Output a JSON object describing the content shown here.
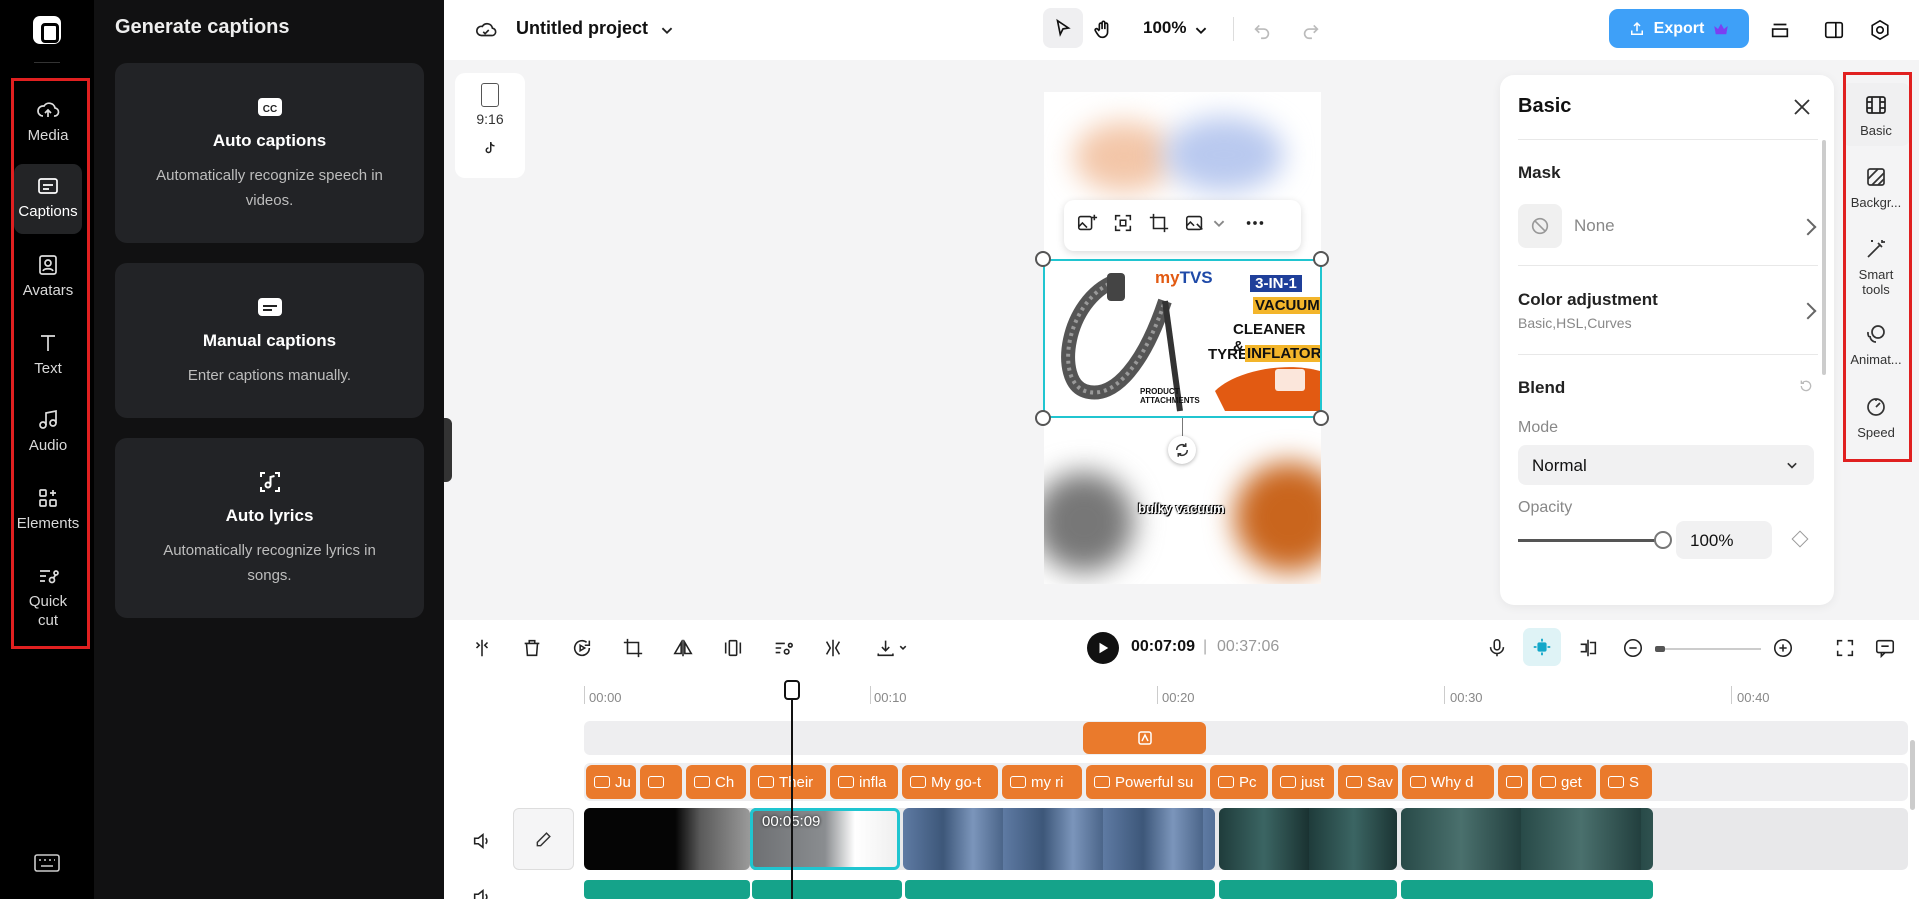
{
  "rail": {
    "items": [
      {
        "label": "Media",
        "icon": "cloud-upload-icon"
      },
      {
        "label": "Captions",
        "icon": "captions-icon"
      },
      {
        "label": "Avatars",
        "icon": "avatar-icon"
      },
      {
        "label": "Text",
        "icon": "text-icon"
      },
      {
        "label": "Audio",
        "icon": "music-note-icon"
      },
      {
        "label": "Elements",
        "icon": "elements-icon"
      },
      {
        "label": "Quick cut",
        "icon": "quick-cut-icon"
      }
    ],
    "keyboard_icon": "keyboard-icon"
  },
  "captions_panel": {
    "title": "Generate captions",
    "cards": [
      {
        "title": "Auto captions",
        "desc": "Automatically recognize speech in videos.",
        "icon": "cc-icon"
      },
      {
        "title": "Manual captions",
        "desc": "Enter captions manually.",
        "icon": "subtitles-icon"
      },
      {
        "title": "Auto lyrics",
        "desc": "Automatically recognize lyrics in songs.",
        "icon": "lyrics-icon"
      }
    ]
  },
  "topbar": {
    "project_name": "Untitled project",
    "zoom": "100%",
    "export_label": "Export"
  },
  "canvas": {
    "ratio": "9:16",
    "subtitle": "bulky vacuum",
    "product": {
      "brand_pre": "my",
      "brand": "TVS",
      "badge": "3-IN-1",
      "line1": "VACUUM",
      "line2": "CLEANER &",
      "line3": "TYRE",
      "line4": "INFLATOR",
      "note": "PRODUCT ATTACHMENTS"
    }
  },
  "props": {
    "title": "Basic",
    "mask_title": "Mask",
    "mask_value": "None",
    "color_title": "Color adjustment",
    "color_sub": "Basic,HSL,Curves",
    "blend_title": "Blend",
    "mode_label": "Mode",
    "mode_value": "Normal",
    "opacity_label": "Opacity",
    "opacity_value": "100%",
    "opacity_level": 1.0
  },
  "right_rail": {
    "items": [
      {
        "label": "Basic",
        "icon": "film-icon"
      },
      {
        "label": "Backgr...",
        "icon": "background-icon"
      },
      {
        "label": "Smart tools",
        "icon": "magic-wand-icon"
      },
      {
        "label": "Animat...",
        "icon": "animation-icon"
      },
      {
        "label": "Speed",
        "icon": "speed-icon"
      }
    ]
  },
  "timeline": {
    "current_time": "00:07:09",
    "separator": "|",
    "total_time": "00:37:06",
    "ticks": [
      "00:00",
      "00:10",
      "00:20",
      "00:30",
      "00:40"
    ],
    "clip_time": "00:05:09",
    "captions": [
      "Ju",
      "",
      "Ch",
      "Their",
      "infla",
      "My go-t",
      "my ri",
      "Powerful su",
      "Pc",
      "just",
      "Sav",
      "Why d",
      "",
      "get",
      "S"
    ]
  },
  "colors": {
    "accent": "#3ea0f8",
    "caption": "#ea7a2c",
    "selection": "#20c5d0",
    "wave": "#15a38a",
    "highlight": "#e02020"
  }
}
